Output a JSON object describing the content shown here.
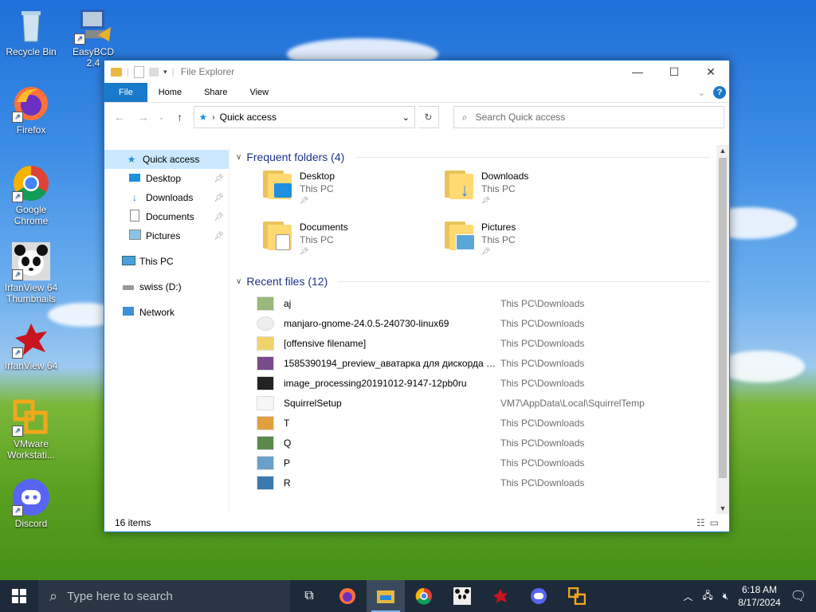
{
  "desktop": {
    "icons": [
      {
        "label": "Recycle Bin",
        "icon": "recycle-bin-icon"
      },
      {
        "label": "EasyBCD 2.4",
        "icon": "easybcd-icon"
      },
      {
        "label": "Firefox",
        "icon": "firefox-icon"
      },
      {
        "label": "Google Chrome",
        "icon": "chrome-icon"
      },
      {
        "label": "IrfanView 64 Thumbnails",
        "icon": "irfanview-thumbnails-icon"
      },
      {
        "label": "IrfanView 64",
        "icon": "irfanview-icon"
      },
      {
        "label": "VMware Workstati...",
        "icon": "vmware-icon"
      },
      {
        "label": "Discord",
        "icon": "discord-icon"
      }
    ]
  },
  "window": {
    "title": "File Explorer",
    "controls": {
      "minimize": "—",
      "maximize": "☐",
      "close": "✕"
    },
    "ribbon_tabs": [
      "File",
      "Home",
      "Share",
      "View"
    ],
    "address": "Quick access",
    "search_placeholder": "Search Quick access",
    "nav": {
      "quick_access": "Quick access",
      "items": [
        {
          "label": "Desktop",
          "icon": "desktop-folder-icon"
        },
        {
          "label": "Downloads",
          "icon": "downloads-icon"
        },
        {
          "label": "Documents",
          "icon": "documents-icon"
        },
        {
          "label": "Pictures",
          "icon": "pictures-icon"
        }
      ],
      "this_pc": "This PC",
      "drive": "swiss (D:)",
      "network": "Network"
    },
    "frequent": {
      "header": "Frequent folders (4)",
      "folders": [
        {
          "name": "Desktop",
          "sub": "This PC",
          "badge": "#1f8fe0"
        },
        {
          "name": "Downloads",
          "sub": "This PC",
          "badge": "#2a86e0"
        },
        {
          "name": "Documents",
          "sub": "This PC",
          "badge": "#e8e8e8"
        },
        {
          "name": "Pictures",
          "sub": "This PC",
          "badge": "#5aa6d8"
        }
      ]
    },
    "recent": {
      "header": "Recent files (12)",
      "files": [
        {
          "name": "aj",
          "loc": "This PC\\Downloads",
          "thumb": "#9ab87a"
        },
        {
          "name": "manjaro-gnome-24.0.5-240730-linux69",
          "loc": "This PC\\Downloads",
          "thumb": "#eeeeee"
        },
        {
          "name": "[offensive filename]",
          "loc": "This PC\\Downloads",
          "thumb": "#f2d36b"
        },
        {
          "name": "1585390194_preview_аватарка для дискорда 6 ...",
          "loc": "This PC\\Downloads",
          "thumb": "#7a4a8c"
        },
        {
          "name": "image_processing20191012-9147-12pb0ru",
          "loc": "This PC\\Downloads",
          "thumb": "#222222"
        },
        {
          "name": "SquirrelSetup",
          "loc": "VM7\\AppData\\Local\\SquirrelTemp",
          "thumb": "#f7f7f7"
        },
        {
          "name": "T",
          "loc": "This PC\\Downloads",
          "thumb": "#e0a040"
        },
        {
          "name": "Q",
          "loc": "This PC\\Downloads",
          "thumb": "#5a8a4a"
        },
        {
          "name": "P",
          "loc": "This PC\\Downloads",
          "thumb": "#6aa0c8"
        },
        {
          "name": "R",
          "loc": "This PC\\Downloads",
          "thumb": "#3a7ab0"
        }
      ]
    },
    "status": "16 items"
  },
  "taskbar": {
    "search_placeholder": "Type here to search",
    "time": "6:18 AM",
    "date": "8/17/2024"
  }
}
